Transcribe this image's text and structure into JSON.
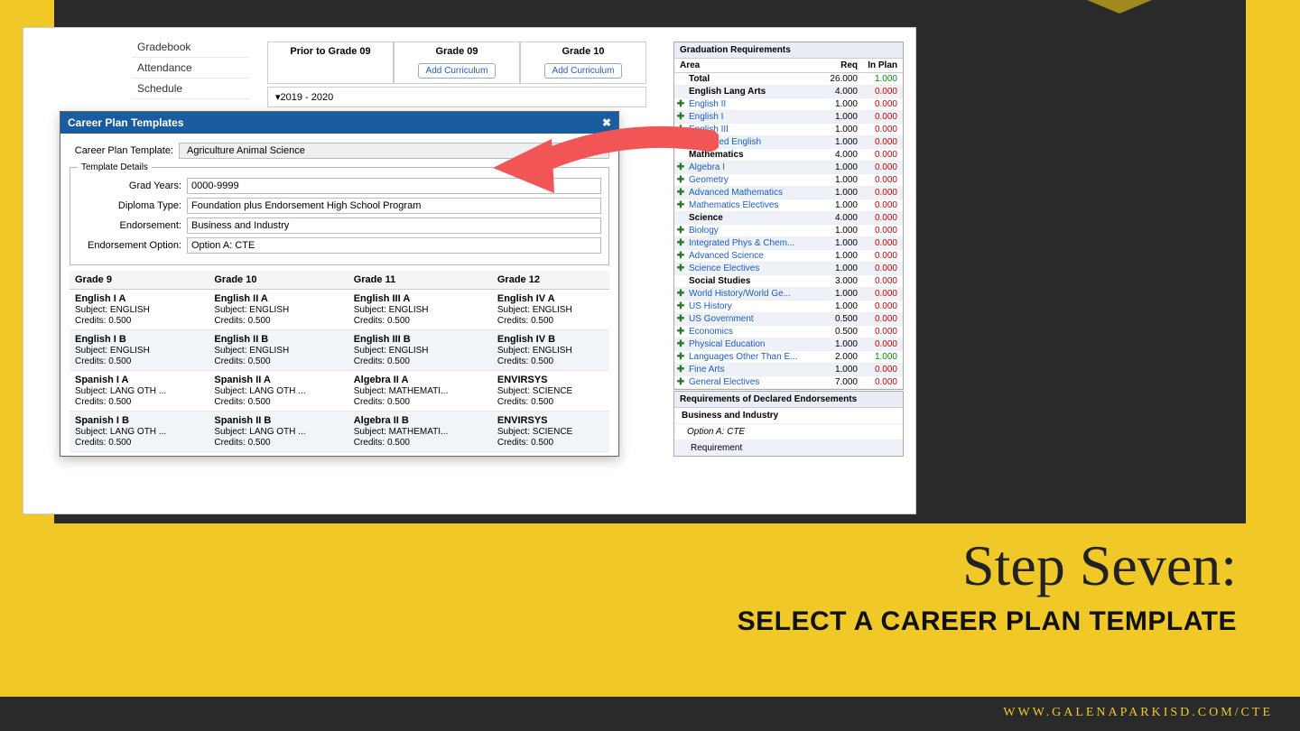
{
  "sidebar": {
    "items": [
      "Gradebook",
      "Attendance",
      "Schedule"
    ]
  },
  "gradeHeaders": [
    "Prior to Grade 09",
    "Grade 09",
    "Grade 10"
  ],
  "addCurriculum": "Add Curriculum",
  "yearRange": "▾2019 - 2020",
  "modal": {
    "title": "Career Plan Templates",
    "closeIcon": "✖",
    "templateLabel": "Career Plan Template:",
    "templateValue": "Agriculture Animal Science",
    "detailsLegend": "Template Details",
    "fields": [
      {
        "label": "Grad Years:",
        "value": "0000-9999"
      },
      {
        "label": "Diploma Type:",
        "value": "Foundation plus Endorsement High School Program"
      },
      {
        "label": "Endorsement:",
        "value": "Business and Industry"
      },
      {
        "label": "Endorsement Option:",
        "value": "Option A: CTE"
      }
    ],
    "gradeCols": [
      "Grade 9",
      "Grade 10",
      "Grade 11",
      "Grade 12"
    ],
    "rows": [
      [
        {
          "name": "English I A",
          "sub": "ENGLISH",
          "cred": "0.500"
        },
        {
          "name": "English II A",
          "sub": "ENGLISH",
          "cred": "0.500"
        },
        {
          "name": "English III A",
          "sub": "ENGLISH",
          "cred": "0.500"
        },
        {
          "name": "English IV A",
          "sub": "ENGLISH",
          "cred": "0.500"
        }
      ],
      [
        {
          "name": "English I B",
          "sub": "ENGLISH",
          "cred": "0.500"
        },
        {
          "name": "English II B",
          "sub": "ENGLISH",
          "cred": "0.500"
        },
        {
          "name": "English III B",
          "sub": "ENGLISH",
          "cred": "0.500"
        },
        {
          "name": "English IV B",
          "sub": "ENGLISH",
          "cred": "0.500"
        }
      ],
      [
        {
          "name": "Spanish I A",
          "sub": "LANG OTH ...",
          "cred": "0.500"
        },
        {
          "name": "Spanish II A",
          "sub": "LANG OTH ...",
          "cred": "0.500"
        },
        {
          "name": "Algebra II A",
          "sub": "MATHEMATI...",
          "cred": "0.500"
        },
        {
          "name": "ENVIRSYS",
          "sub": "SCIENCE",
          "cred": "0.500"
        }
      ],
      [
        {
          "name": "Spanish I B",
          "sub": "LANG OTH ...",
          "cred": "0.500"
        },
        {
          "name": "Spanish II B",
          "sub": "LANG OTH ...",
          "cred": "0.500"
        },
        {
          "name": "Algebra II B",
          "sub": "MATHEMATI...",
          "cred": "0.500"
        },
        {
          "name": "ENVIRSYS",
          "sub": "SCIENCE",
          "cred": "0.500"
        }
      ]
    ],
    "subjectLabel": "Subject:",
    "creditsLabel": "Credits:"
  },
  "reqPanel": {
    "title": "Graduation Requirements",
    "cols": [
      "Area",
      "Req",
      "In Plan"
    ],
    "rows": [
      {
        "plus": "",
        "area": "Total",
        "bold": true,
        "req": "26.000",
        "inplan": "1.000",
        "green": true
      },
      {
        "plus": "",
        "area": "English Lang Arts",
        "bold": true,
        "req": "4.000",
        "inplan": "0.000"
      },
      {
        "plus": "✚",
        "area": "English II",
        "lnk": true,
        "req": "1.000",
        "inplan": "0.000"
      },
      {
        "plus": "✚",
        "area": "English I",
        "lnk": true,
        "req": "1.000",
        "inplan": "0.000"
      },
      {
        "plus": "✚",
        "area": "English III",
        "lnk": true,
        "req": "1.000",
        "inplan": "0.000"
      },
      {
        "plus": "✚",
        "area": "Advanced English",
        "lnk": true,
        "req": "1.000",
        "inplan": "0.000"
      },
      {
        "plus": "",
        "area": "Mathematics",
        "bold": true,
        "req": "4.000",
        "inplan": "0.000"
      },
      {
        "plus": "✚",
        "area": "Algebra I",
        "lnk": true,
        "req": "1.000",
        "inplan": "0.000"
      },
      {
        "plus": "✚",
        "area": "Geometry",
        "lnk": true,
        "req": "1.000",
        "inplan": "0.000"
      },
      {
        "plus": "✚",
        "area": "Advanced Mathematics",
        "lnk": true,
        "req": "1.000",
        "inplan": "0.000"
      },
      {
        "plus": "✚",
        "area": "Mathematics Electives",
        "lnk": true,
        "req": "1.000",
        "inplan": "0.000"
      },
      {
        "plus": "",
        "area": "Science",
        "bold": true,
        "req": "4.000",
        "inplan": "0.000"
      },
      {
        "plus": "✚",
        "area": "Biology",
        "lnk": true,
        "req": "1.000",
        "inplan": "0.000"
      },
      {
        "plus": "✚",
        "area": "Integrated Phys & Chem...",
        "lnk": true,
        "req": "1.000",
        "inplan": "0.000"
      },
      {
        "plus": "✚",
        "area": "Advanced Science",
        "lnk": true,
        "req": "1.000",
        "inplan": "0.000"
      },
      {
        "plus": "✚",
        "area": "Science Electives",
        "lnk": true,
        "req": "1.000",
        "inplan": "0.000"
      },
      {
        "plus": "",
        "area": "Social Studies",
        "bold": true,
        "req": "3.000",
        "inplan": "0.000"
      },
      {
        "plus": "✚",
        "area": "World History/World Ge...",
        "lnk": true,
        "req": "1.000",
        "inplan": "0.000"
      },
      {
        "plus": "✚",
        "area": "US History",
        "lnk": true,
        "req": "1.000",
        "inplan": "0.000"
      },
      {
        "plus": "✚",
        "area": "US Government",
        "lnk": true,
        "req": "0.500",
        "inplan": "0.000"
      },
      {
        "plus": "✚",
        "area": "Economics",
        "lnk": true,
        "req": "0.500",
        "inplan": "0.000"
      },
      {
        "plus": "✚",
        "area": "Physical Education",
        "lnk": true,
        "req": "1.000",
        "inplan": "0.000"
      },
      {
        "plus": "✚",
        "area": "Languages Other Than E...",
        "lnk": true,
        "req": "2.000",
        "inplan": "1.000",
        "green": true
      },
      {
        "plus": "✚",
        "area": "Fine Arts",
        "lnk": true,
        "req": "1.000",
        "inplan": "0.000"
      },
      {
        "plus": "✚",
        "area": "General Electives",
        "lnk": true,
        "req": "7.000",
        "inplan": "0.000"
      }
    ]
  },
  "endorse": {
    "title": "Requirements of Declared Endorsements",
    "line1": "Business and Industry",
    "line2": "Option A: CTE",
    "line3": "Requirement"
  },
  "slide": {
    "title": "Step Seven:",
    "sub": "SELECT A CAREER PLAN TEMPLATE",
    "footer": "WWW.GALENAPARKISD.COM/CTE"
  }
}
